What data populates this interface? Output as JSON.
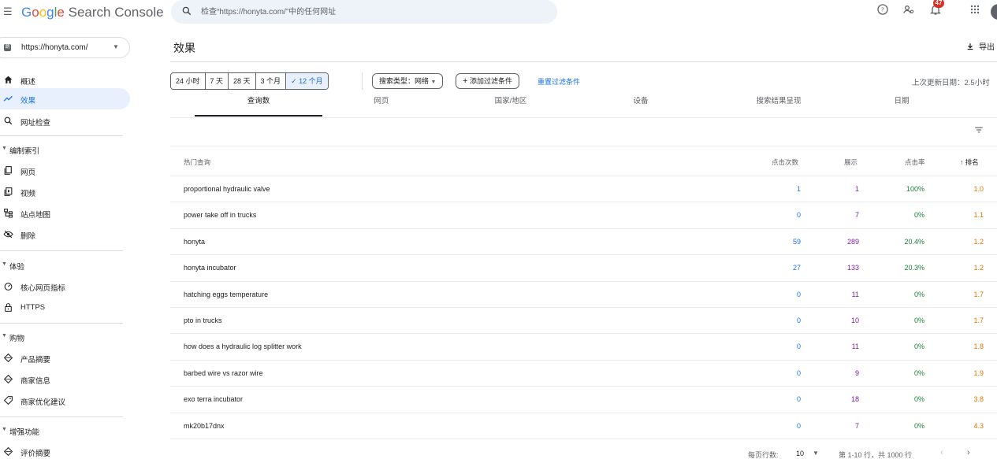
{
  "app": {
    "logo_google": [
      "G",
      "o",
      "o",
      "g",
      "l",
      "e"
    ],
    "logo_rest": " Search Console"
  },
  "search": {
    "placeholder": "检查“https://honyta.com/”中的任何网址"
  },
  "topbar": {
    "notification_count": "47"
  },
  "sidebar": {
    "property": "https://honyta.com/",
    "items": [
      {
        "label": "概述",
        "icon": "home-icon"
      },
      {
        "label": "效果",
        "icon": "trending-icon",
        "active": true
      },
      {
        "label": "网址检查",
        "icon": "search-icon"
      }
    ],
    "sections": [
      {
        "title": "编制索引",
        "items": [
          {
            "label": "网页",
            "icon": "pages-icon"
          },
          {
            "label": "视频",
            "icon": "video-pages-icon"
          },
          {
            "label": "站点地图",
            "icon": "sitemap-icon"
          },
          {
            "label": "删除",
            "icon": "removals-icon"
          }
        ]
      },
      {
        "title": "体验",
        "items": [
          {
            "label": "核心网页指标",
            "icon": "speed-icon"
          },
          {
            "label": "HTTPS",
            "icon": "lock-icon"
          }
        ]
      },
      {
        "title": "购物",
        "items": [
          {
            "label": "产品摘要",
            "icon": "diamond-icon"
          },
          {
            "label": "商家信息",
            "icon": "diamond-icon"
          },
          {
            "label": "商家优化建议",
            "icon": "tag-icon"
          }
        ]
      },
      {
        "title": "增强功能",
        "items": [
          {
            "label": "评价摘要",
            "icon": "diamond-icon"
          }
        ]
      }
    ]
  },
  "main": {
    "title": "效果",
    "export_label": "导出",
    "date_ranges": [
      "24 小时",
      "7 天",
      "28 天",
      "3 个月",
      "12 个月"
    ],
    "selected_range": "12 个月",
    "selected_check": "✓",
    "search_type": "搜索类型：网络",
    "add_filter": "添加过滤条件",
    "reset_filters": "重置过滤条件",
    "last_updated": "上次更新日期：2.5小时",
    "tabs": [
      "查询数",
      "网页",
      "国家/地区",
      "设备",
      "搜索结果呈现",
      "日期"
    ],
    "active_tab": "查询数"
  },
  "table": {
    "headers": {
      "query": "热门查询",
      "clicks": "点击次数",
      "impressions": "展示",
      "ctr": "点击率",
      "position": "排名",
      "sort_arrow": "↑"
    },
    "rows": [
      {
        "query": "proportional hydraulic valve",
        "clicks": "1",
        "impressions": "1",
        "ctr": "100%",
        "position": "1.0"
      },
      {
        "query": "power take off in trucks",
        "clicks": "0",
        "impressions": "7",
        "ctr": "0%",
        "position": "1.1"
      },
      {
        "query": "honyta",
        "clicks": "59",
        "impressions": "289",
        "ctr": "20.4%",
        "position": "1.2"
      },
      {
        "query": "honyta incubator",
        "clicks": "27",
        "impressions": "133",
        "ctr": "20.3%",
        "position": "1.2"
      },
      {
        "query": "hatching eggs temperature",
        "clicks": "0",
        "impressions": "11",
        "ctr": "0%",
        "position": "1.7"
      },
      {
        "query": "pto in trucks",
        "clicks": "0",
        "impressions": "10",
        "ctr": "0%",
        "position": "1.7"
      },
      {
        "query": "how does a hydraulic log splitter work",
        "clicks": "0",
        "impressions": "11",
        "ctr": "0%",
        "position": "1.8"
      },
      {
        "query": "barbed wire vs razor wire",
        "clicks": "0",
        "impressions": "9",
        "ctr": "0%",
        "position": "1.9"
      },
      {
        "query": "exo terra incubator",
        "clicks": "0",
        "impressions": "18",
        "ctr": "0%",
        "position": "3.8"
      },
      {
        "query": "mk20b17dnx",
        "clicks": "0",
        "impressions": "7",
        "ctr": "0%",
        "position": "4.3"
      }
    ]
  },
  "pagination": {
    "rows_per_page_label": "每页行数:",
    "rows_per_page": "10",
    "range": "第 1-10 行，共 1000 行"
  }
}
